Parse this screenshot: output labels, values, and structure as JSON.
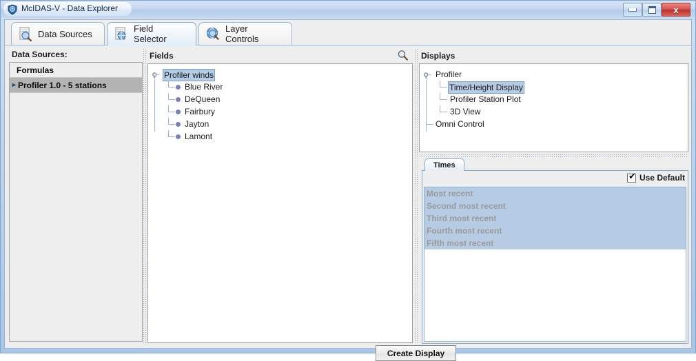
{
  "window": {
    "title": "McIDAS-V - Data Explorer",
    "app_icon": "globe-shield-icon",
    "controls": {
      "minimize": "minimize-icon",
      "maximize": "maximize-icon",
      "close_label": "x"
    }
  },
  "tabs": [
    {
      "label": "Data Sources",
      "icon": "document-magnifier-icon",
      "selected": false
    },
    {
      "label": "Field Selector",
      "icon": "document-globe-icon",
      "selected": true
    },
    {
      "label": "Layer Controls",
      "icon": "globe-magnifier-icon",
      "selected": false
    }
  ],
  "data_sources": {
    "label": "Data Sources:",
    "items": [
      {
        "label": "Formulas",
        "selected": false
      },
      {
        "label": "Profiler 1.0 - 5 stations",
        "selected": true
      }
    ]
  },
  "fields": {
    "title": "Fields",
    "search_icon": "search-icon",
    "root": {
      "label": "Profiler winds",
      "selected": true
    },
    "children": [
      {
        "label": "Blue River"
      },
      {
        "label": "DeQueen"
      },
      {
        "label": "Fairbury"
      },
      {
        "label": "Jayton"
      },
      {
        "label": "Lamont"
      }
    ]
  },
  "displays": {
    "title": "Displays",
    "root": {
      "label": "Profiler"
    },
    "children": [
      {
        "label": "Time/Height Display",
        "selected": true
      },
      {
        "label": "Profiler Station Plot",
        "selected": false
      },
      {
        "label": "3D View",
        "selected": false
      }
    ],
    "sibling": {
      "label": "Omni Control"
    }
  },
  "times": {
    "tab_label": "Times",
    "use_default_label": "Use Default",
    "use_default_checked": true,
    "check_glyph": "✔",
    "items": [
      "Most recent",
      "Second most recent",
      "Third most recent",
      "Fourth most recent",
      "Fifth most recent"
    ]
  },
  "footer": {
    "create_display_label": "Create Display"
  },
  "colors": {
    "selection_blue": "#b6cce4",
    "selection_border": "#7a9fc4",
    "panel_bg": "#efeeee",
    "tree_line": "#9fb4cb",
    "leaf_dot": "#7b7fb4",
    "title_text": "#102a47"
  }
}
